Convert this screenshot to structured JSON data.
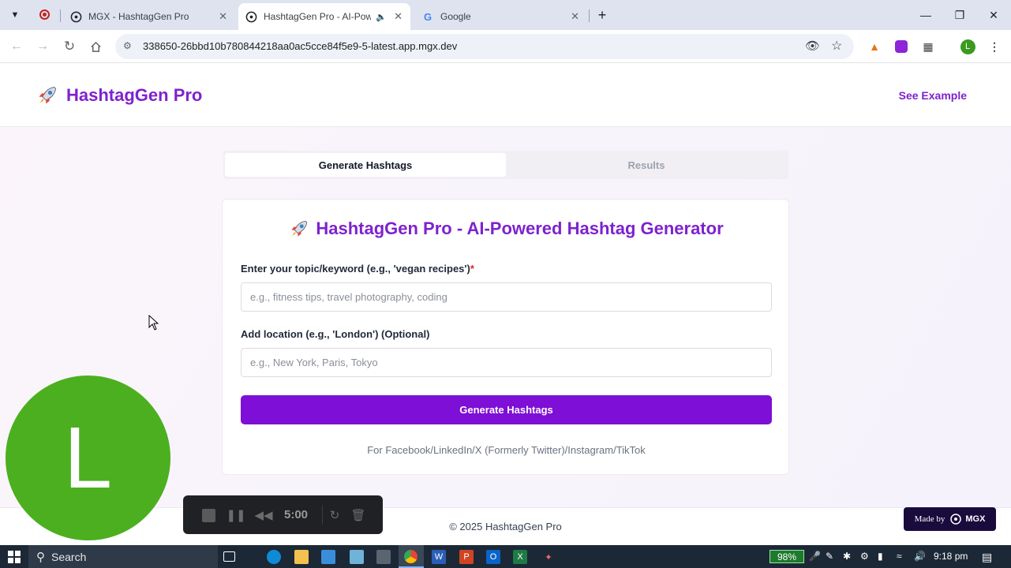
{
  "browser": {
    "tabs": [
      {
        "label": "MGX - HashtagGen Pro",
        "icon": "mgx-tab-icon",
        "active": false
      },
      {
        "label": "HashtagGen Pro - AI-Powe",
        "icon": "mgx-tab-icon",
        "active": true
      },
      {
        "label": "Google",
        "icon": "google-icon",
        "active": false
      }
    ],
    "url": "338650-26bbd10b780844218aa0ac5cce84f5e9-5-latest.app.mgx.dev",
    "profile_initial": "L"
  },
  "header": {
    "brand": "HashtagGen Pro",
    "see_example": "See Example"
  },
  "tabs": {
    "generate": "Generate Hashtags",
    "results": "Results"
  },
  "card": {
    "title": "HashtagGen Pro - AI-Powered Hashtag Generator",
    "topic_label": "Enter your topic/keyword (e.g., 'vegan recipes')",
    "required_mark": "*",
    "topic_placeholder": "e.g., fitness tips, travel photography, coding",
    "location_label": "Add location (e.g., 'London') (Optional)",
    "location_placeholder": "e.g., New York, Paris, Tokyo",
    "button": "Generate Hashtags",
    "platforms": "For Facebook/LinkedIn/X (Formerly Twitter)/Instagram/TikTok"
  },
  "footer": {
    "copyright": "© 2025 HashtagGen Pro",
    "made_by": "Made by",
    "made_by_brand": "MGX"
  },
  "overlay": {
    "avatar_initial": "L",
    "recorder_time": "5:00"
  },
  "taskbar": {
    "search": "Search",
    "battery": "98%",
    "time": "9:18 pm"
  },
  "colors": {
    "brand_purple": "#7e22ce",
    "button_purple": "#7e0fd6",
    "avatar_green": "#4caf1f"
  }
}
